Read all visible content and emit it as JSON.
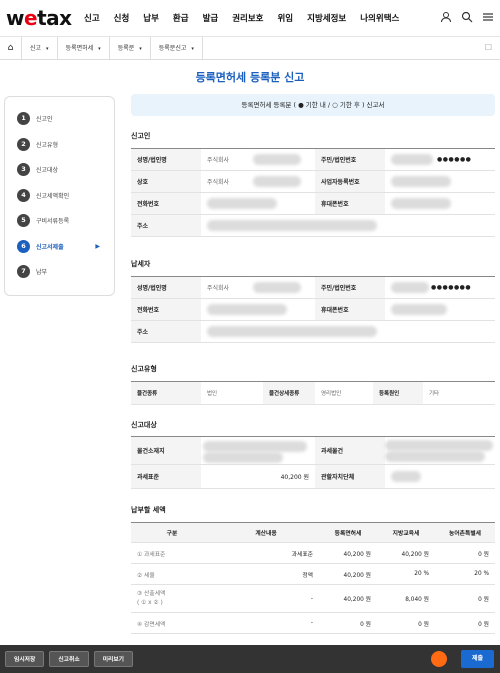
{
  "logo": {
    "text_a": "w",
    "text_b": "tax"
  },
  "gnb": {
    "menu": [
      "신고",
      "신청",
      "납부",
      "환급",
      "발급",
      "권리보호",
      "위임",
      "지방세정보",
      "나의위택스"
    ],
    "icons": [
      "user-icon",
      "search-icon",
      "menu-icon"
    ]
  },
  "breadcrumb": {
    "home": "⌂",
    "items": [
      "신고",
      "등록면허세",
      "등록분",
      "등록분신고"
    ],
    "arrow": "▾",
    "bookmark": "☐"
  },
  "page_title": "등록면허세 등록분 신고",
  "notice": "등록면허세 등록분 ( ● 기한 내 / ○ 기한 후 ) 신고서",
  "steps": [
    {
      "num": "1",
      "label": "신고인"
    },
    {
      "num": "2",
      "label": "신고유형"
    },
    {
      "num": "3",
      "label": "신고대상"
    },
    {
      "num": "4",
      "label": "신고세액확인"
    },
    {
      "num": "5",
      "label": "구비서류등록"
    },
    {
      "num": "6",
      "label": "신고서제출",
      "arrow": "▶"
    },
    {
      "num": "7",
      "label": "납부"
    }
  ],
  "reporter": {
    "heading": "신고인",
    "rows": [
      {
        "l1": "성명/법인명",
        "v1": "주식회사",
        "l2": "주민/법인번호",
        "v2": "●●●●●●"
      },
      {
        "l1": "상호",
        "v1": "주식회사",
        "l2": "사업자등록번호",
        "v2": ""
      },
      {
        "l1": "전화번호",
        "v1": "",
        "l2": "휴대폰번호",
        "v2": ""
      },
      {
        "l1": "주소",
        "v1": ""
      }
    ]
  },
  "taxpayer": {
    "heading": "납세자",
    "rows": [
      {
        "l1": "성명/법인명",
        "v1": "주식회사",
        "l2": "주민/법인번호",
        "v2": "●●●●●●●"
      },
      {
        "l1": "전화번호",
        "v1": "",
        "l2": "휴대폰번호",
        "v2": ""
      },
      {
        "l1": "주소",
        "v1": ""
      }
    ]
  },
  "report_type": {
    "heading": "신고유형",
    "l1": "물건종류",
    "v1": "법인",
    "l2": "물건상세종류",
    "v2": "영리법인",
    "l3": "등록원인",
    "v3": "기타"
  },
  "report_target": {
    "heading": "신고대상",
    "l1": "물건소재지",
    "l2": "과세물건",
    "l3": "과세표준",
    "v3": "40,200 원",
    "l4": "관할자치단체"
  },
  "tax": {
    "heading": "납부할 세액",
    "headers": [
      "구분",
      "계산내용",
      "등록면허세",
      "지방교육세",
      "농어촌특별세"
    ],
    "rows": [
      {
        "label": "① 과세표준",
        "calc": "과세표준",
        "a": "40,200 원",
        "b": "40,200 원",
        "c": "0 원"
      },
      {
        "label": "② 세율",
        "calc": "정액",
        "a": "40,200 원",
        "b": "20 %",
        "c": "20 %"
      },
      {
        "label": "③ 산출세액\n( ① x ② )",
        "calc": "-",
        "a": "40,200 원",
        "b": "8,040 원",
        "c": "0 원"
      },
      {
        "label": "④ 감면세액",
        "calc": "-",
        "a": "0 원",
        "b": "0 원",
        "c": "0 원"
      }
    ]
  },
  "bottom": {
    "temp_save": "임시저장",
    "cancel": "신고취소",
    "preview": "미리보기",
    "submit": "제출"
  }
}
